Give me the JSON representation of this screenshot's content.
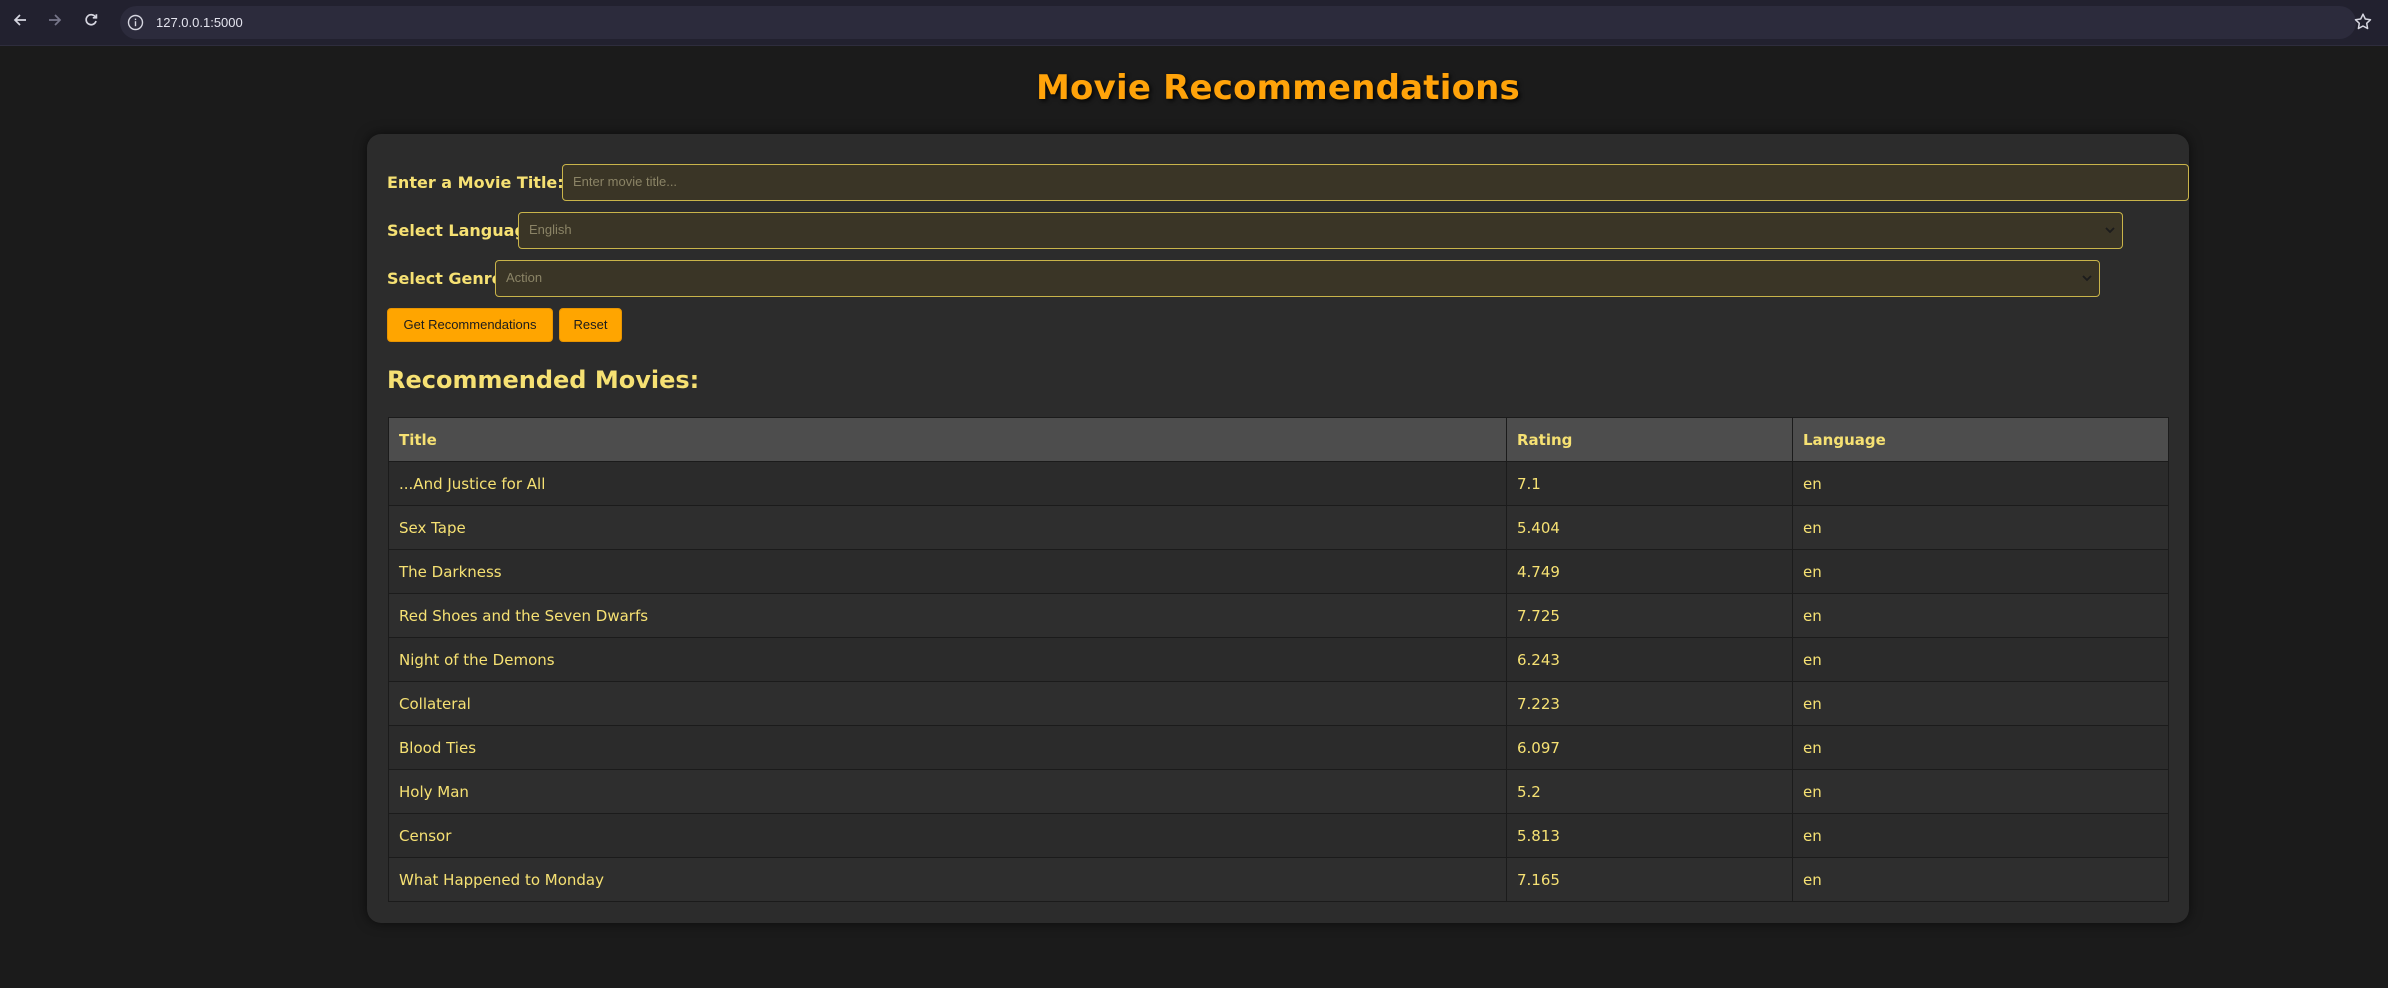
{
  "browser": {
    "url": "127.0.0.1:5000",
    "back_icon": "arrow-left-icon",
    "forward_icon": "arrow-right-icon",
    "reload_icon": "reload-icon",
    "info_icon": "info-icon",
    "bookmark_icon": "star-icon"
  },
  "page": {
    "title": "Movie Recommendations"
  },
  "form": {
    "title_label": "Enter a Movie Title:",
    "title_placeholder": "Enter movie title...",
    "language_label": "Select Language:",
    "language_value": "English",
    "genre_label": "Select Genre:",
    "genre_value": "Action",
    "recommend_button": "Get Recommendations",
    "reset_button": "Reset"
  },
  "results": {
    "heading": "Recommended Movies:",
    "columns": [
      "Title",
      "Rating",
      "Language"
    ],
    "rows": [
      {
        "title": "...And Justice for All",
        "rating": "7.1",
        "language": "en"
      },
      {
        "title": "Sex Tape",
        "rating": "5.404",
        "language": "en"
      },
      {
        "title": "The Darkness",
        "rating": "4.749",
        "language": "en"
      },
      {
        "title": "Red Shoes and the Seven Dwarfs",
        "rating": "7.725",
        "language": "en"
      },
      {
        "title": "Night of the Demons",
        "rating": "6.243",
        "language": "en"
      },
      {
        "title": "Collateral",
        "rating": "7.223",
        "language": "en"
      },
      {
        "title": "Blood Ties",
        "rating": "6.097",
        "language": "en"
      },
      {
        "title": "Holy Man",
        "rating": "5.2",
        "language": "en"
      },
      {
        "title": "Censor",
        "rating": "5.813",
        "language": "en"
      },
      {
        "title": "What Happened to Monday",
        "rating": "7.165",
        "language": "en"
      }
    ]
  },
  "colors": {
    "accent": "#ffa500",
    "text": "#f6e173",
    "background": "#1b1b1b",
    "card": "#2c2c2c"
  }
}
